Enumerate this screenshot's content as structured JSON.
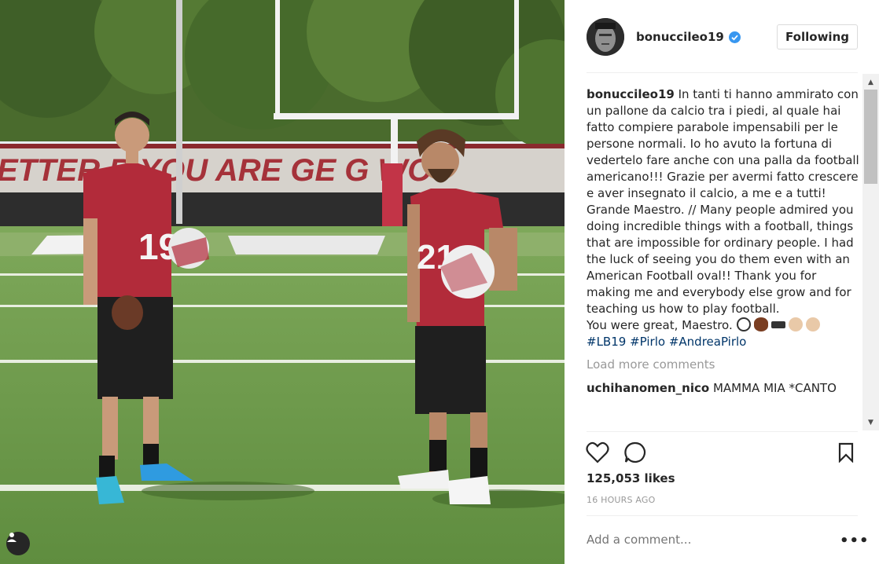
{
  "post": {
    "username": "bonuccileo19",
    "follow_label": "Following",
    "caption_user": "bonuccileo19",
    "caption": " In tanti ti hanno ammirato con un pallone da calcio tra i piedi, al quale hai fatto compiere parabole impensabili per le persone normali. Io ho avuto la fortuna di vedertelo fare anche con una palla da football americano!!! Grazie per avermi fatto crescere e aver insegnato il calcio, a me e a tutti! Grande Maestro. // Many people admired you doing incredible things with a football, things that are impossible for ordinary people. I had the luck of seeing you do them even with an American Football oval!! Thank you for making me and everybody else grow and for teaching us how to play football.",
    "caption_end": "You were great, Maestro.",
    "hashtags": [
      "#LB19",
      "#Pirlo",
      "#AndreaPirlo"
    ],
    "load_more": "Load more comments",
    "comments": [
      {
        "user": "uchihanomen_nico",
        "text": "MAMMA MIA *CANTO"
      }
    ],
    "likes": "125,053 likes",
    "time": "16 HOURS AGO",
    "comment_placeholder": "Add a comment...",
    "more_label": "•••"
  },
  "photo": {
    "banner_text": "ETTER  R YOU ARE GE   G WO",
    "player_left_number": "19",
    "player_right_number": "21"
  },
  "icons": {
    "verified": "verified-badge-icon",
    "heart": "heart-icon",
    "comment": "comment-icon",
    "bookmark": "bookmark-icon",
    "user_tag": "user-tag-icon"
  },
  "colors": {
    "verified_blue": "#3897f0",
    "hashtag": "#003569",
    "muted": "#999999",
    "jersey": "#b22b3a",
    "grass": "#6f9a4c"
  }
}
